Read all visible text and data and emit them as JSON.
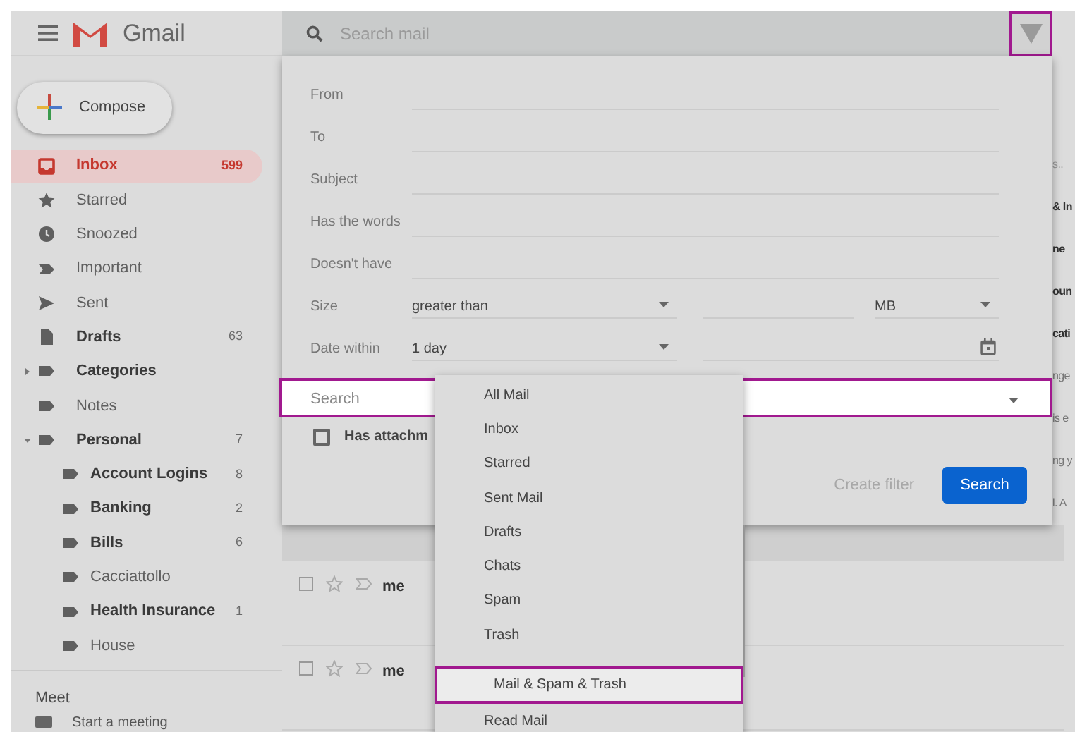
{
  "header": {
    "logo_text": "Gmail"
  },
  "compose": {
    "label": "Compose"
  },
  "nav": [
    {
      "kind": "inbox",
      "label": "Inbox",
      "count": "599",
      "unread": true,
      "selected": true
    },
    {
      "kind": "starred",
      "label": "Starred",
      "unread": false,
      "selected": false
    },
    {
      "kind": "snoozed",
      "label": "Snoozed",
      "unread": false,
      "selected": false
    },
    {
      "kind": "important",
      "label": "Important",
      "unread": false,
      "selected": false
    },
    {
      "kind": "sent",
      "label": "Sent",
      "unread": false,
      "selected": false
    },
    {
      "kind": "drafts",
      "label": "Drafts",
      "count": "63",
      "unread": true,
      "selected": false
    },
    {
      "kind": "label",
      "label": "Categories",
      "unread": true,
      "selected": false,
      "expanded": false
    },
    {
      "kind": "label",
      "label": "Notes",
      "unread": false,
      "selected": false
    },
    {
      "kind": "label",
      "label": "Personal",
      "count": "7",
      "unread": true,
      "selected": false,
      "expanded": true,
      "children": [
        {
          "kind": "label",
          "label": "Account Logins",
          "count": "8",
          "unread": true,
          "selected": false
        },
        {
          "kind": "label",
          "label": "Banking",
          "count": "2",
          "unread": true,
          "selected": false
        },
        {
          "kind": "label",
          "label": "Bills",
          "count": "6",
          "unread": true,
          "selected": false
        },
        {
          "kind": "label",
          "label": "Cacciattollo",
          "unread": false,
          "selected": false
        },
        {
          "kind": "label",
          "label": "Health Insurance",
          "count": "1",
          "unread": true,
          "selected": false
        },
        {
          "kind": "label",
          "label": "House",
          "unread": false,
          "selected": false
        }
      ]
    }
  ],
  "meet": {
    "heading": "Meet",
    "items": [
      {
        "label": "Start a meeting"
      }
    ]
  },
  "search_bar": {
    "placeholder": "Search mail"
  },
  "advanced_search": {
    "fields": [
      {
        "kind": "text",
        "label": "From"
      },
      {
        "kind": "text",
        "label": "To"
      },
      {
        "kind": "text",
        "label": "Subject"
      },
      {
        "kind": "text",
        "label": "Has the words"
      },
      {
        "kind": "text",
        "label": "Doesn't have"
      },
      {
        "kind": "size",
        "label": "Size",
        "operator": "greater than",
        "unit": "MB"
      },
      {
        "kind": "date",
        "label": "Date within",
        "value": "1 day"
      }
    ],
    "scope": {
      "label": "Search",
      "expanded": true
    },
    "has_attachment": {
      "label": "Has attachm",
      "checked": false
    },
    "create_filter": {
      "label": "Create filter",
      "disabled": true
    },
    "search_button": {
      "label": "Search"
    }
  },
  "scope_menu": [
    {
      "label": "All Mail",
      "selected": false
    },
    {
      "label": "Inbox",
      "selected": false
    },
    {
      "label": "Starred",
      "selected": false
    },
    {
      "label": "Sent Mail",
      "selected": false
    },
    {
      "label": "Drafts",
      "selected": false
    },
    {
      "label": "Chats",
      "selected": false
    },
    {
      "label": "Spam",
      "selected": false
    },
    {
      "label": "Trash",
      "selected": false
    },
    {
      "label": "Mail & Spam & Trash",
      "selected": true
    },
    {
      "label": "Read Mail",
      "selected": false
    }
  ],
  "list_fragments": [
    "s..",
    "& In",
    "ne",
    "oun",
    "cati",
    "nge",
    "is e",
    "ng y",
    "l. A"
  ],
  "email_rows": [
    {
      "sender": "me",
      "checked": false
    },
    {
      "sender": "me",
      "checked": false
    }
  ]
}
